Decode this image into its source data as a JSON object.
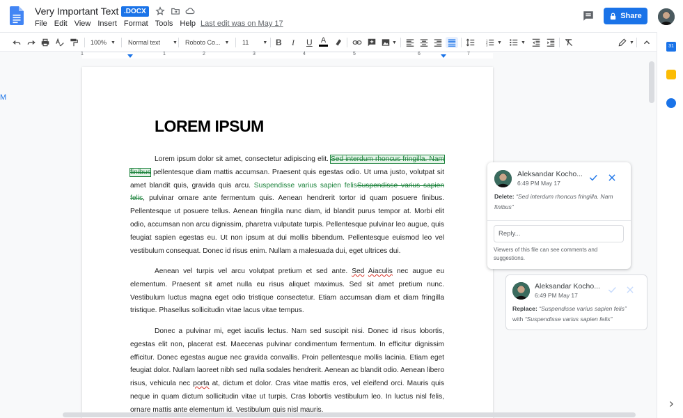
{
  "doc": {
    "title": "Very Important Text",
    "ext_badge": ".DOCX",
    "last_edit": "Last edit was on May 17"
  },
  "menu": [
    "File",
    "Edit",
    "View",
    "Insert",
    "Format",
    "Tools",
    "Help"
  ],
  "header": {
    "share_label": "Share"
  },
  "toolbar": {
    "zoom": "100%",
    "style": "Normal text",
    "font": "Roboto Co...",
    "size": "11"
  },
  "ruler": {
    "numbers": [
      "1",
      "1",
      "2",
      "3",
      "4",
      "5",
      "6",
      "7"
    ]
  },
  "page": {
    "heading": "LOREM IPSUM",
    "p1": {
      "a": "Lorem ipsum dolor sit amet, consectetur adipiscing elit. ",
      "deleted": "Sed interdum rhoncus fringilla. Nam finibus",
      "b": " pellentesque diam mattis accumsan. Praesent quis egestas odio. Ut urna justo, volutpat sit amet blandit quis, gravida quis arcu. ",
      "inserted": "Suspendisse varius sapien felis",
      "replaced": "Suspendisse varius sapien felis",
      "c": ", pulvinar ornare ante fermentum quis. Aenean hendrerit tortor id quam posuere finibus. Pellentesque ut posuere tellus. Aenean fringilla nunc diam, id blandit purus tempor at. Morbi elit odio, accumsan non arcu dignissim, pharetra vulputate turpis. Pellentesque pulvinar leo augue, quis feugiat sapien egestas eu. Ut non ipsum at dui mollis bibendum. Pellentesque euismod leo vel vestibulum consequat. Donec id risus enim. Nullam a malesuada dui, eget ultrices dui."
    },
    "p2": {
      "a": "Aenean vel turpis vel arcu volutpat pretium et sed ante. ",
      "sq1": "Sed",
      "sp": " ",
      "sq2": "Aiaculis",
      "b": " nec augue eu elementum. Praesent sit amet nulla eu risus aliquet maximus. Sed sit amet pretium nunc. Vestibulum luctus magna eget odio tristique consectetur. Etiam accumsan diam et diam fringilla tristique. Phasellus sollicitudin vitae lacus vitae tempus."
    },
    "p3": {
      "a": "Donec a pulvinar mi, eget iaculis lectus. Nam sed suscipit nisi. Donec id risus lobortis, egestas elit non, placerat est. Maecenas pulvinar condimentum fermentum. In efficitur dignissim efficitur. Donec egestas augue nec gravida convallis. Proin pellentesque mollis lacinia. Etiam eget feugiat dolor. Nullam laoreet nibh sed nulla sodales hendrerit. Aenean ac blandit odio. Aenean libero risus, vehicula nec ",
      "sq": "porta",
      "b": " at, dictum et dolor. Cras vitae mattis eros, vel eleifend orci. Mauris quis neque in quam dictum sollicitudin vitae ut turpis. Cras lobortis vestibulum leo. In luctus nisl felis, ornare mattis ante elementum id. Vestibulum quis nisl mauris."
    }
  },
  "comments": [
    {
      "author": "Aleksandar Kocho...",
      "time": "6:49 PM May 17",
      "action": "Delete:",
      "text": "“Sed interdum rhoncus fringilla. Nam finibus”",
      "reply_placeholder": "Reply...",
      "viewers_note": "Viewers of this file can see comments and suggestions."
    },
    {
      "author": "Aleksandar Kocho...",
      "time": "6:49 PM May 17",
      "action": "Replace:",
      "text": "“Suspendisse varius sapien felis”",
      "with": "with",
      "with_text": "“Suspendisse varius sapien felis”"
    }
  ],
  "rail": {
    "calendar_day": "31"
  },
  "colors": {
    "accent": "#1a73e8",
    "suggestion": "#188038"
  }
}
